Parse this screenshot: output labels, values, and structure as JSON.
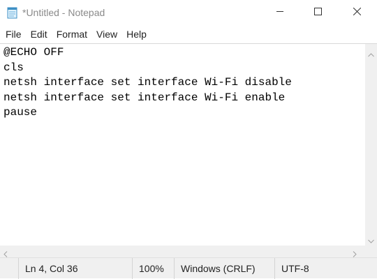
{
  "window": {
    "title": "*Untitled - Notepad"
  },
  "icons": {
    "app": "notepad-icon",
    "minimize": "minimize-icon",
    "maximize": "maximize-icon",
    "close": "close-icon",
    "scroll_up": "chevron-up-icon",
    "scroll_down": "chevron-down-icon",
    "scroll_left": "chevron-left-icon",
    "scroll_right": "chevron-right-icon"
  },
  "menu": {
    "items": [
      "File",
      "Edit",
      "Format",
      "View",
      "Help"
    ]
  },
  "editor": {
    "lines": [
      "@ECHO OFF",
      "cls",
      "netsh interface set interface Wi-Fi disable",
      "netsh interface set interface Wi-Fi enable",
      "pause"
    ]
  },
  "status": {
    "position": "Ln 4, Col 36",
    "zoom": "100%",
    "line_endings": "Windows (CRLF)",
    "encoding": "UTF-8"
  },
  "colors": {
    "title_text": "#8a8a8a",
    "chrome_bg": "#f0f0f0",
    "text": "#000000"
  }
}
